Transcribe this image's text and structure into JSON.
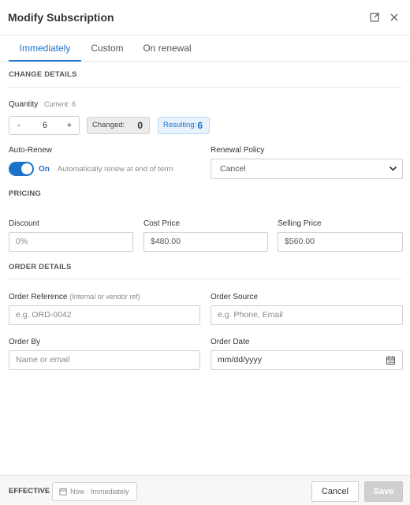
{
  "header": {
    "title": "Modify Subscription",
    "icons": [
      "expand-icon",
      "close-icon"
    ]
  },
  "tabs": [
    {
      "label": "Immediately",
      "active": true
    },
    {
      "label": "Custom",
      "active": false
    },
    {
      "label": "On renewal",
      "active": false
    }
  ],
  "change_details": {
    "title": "CHANGE DETAILS",
    "quantity_label": "Quantity",
    "current_label": "Current: 6",
    "minus": "-",
    "value": "6",
    "plus": "+",
    "changed_label": "Changed:",
    "changed_value": "0",
    "resulting_label": "Resulting:",
    "resulting_value": "6",
    "auto_renew_label": "Auto-Renew",
    "toggle_state": "On",
    "toggle_hint": "Automatically renew at end of term",
    "renewal_policy_label": "Renewal Policy",
    "renewal_policy_value": "Cancel"
  },
  "pricing": {
    "title": "PRICING",
    "discount_label": "Discount",
    "discount_placeholder": "0%",
    "cost_label": "Cost Price",
    "cost_value": "$480.00",
    "selling_label": "Selling Price",
    "selling_value": "$560.00"
  },
  "order_details": {
    "title": "ORDER DETAILS",
    "reference_label": "Order Reference",
    "reference_hint": "(Internal or vendor ref)",
    "reference_placeholder": "e.g. ORD-0042",
    "source_label": "Order Source",
    "source_placeholder": "e.g. Phone, Email",
    "order_by_label": "Order By",
    "order_by_placeholder": "Name or email",
    "order_date_label": "Order Date",
    "order_date_placeholder": "mm/dd/yyyy"
  },
  "footer": {
    "effective_label": "EFFECTIVE",
    "effective_value": "Now · Immediately",
    "cancel": "Cancel",
    "save": "Save"
  },
  "colors": {
    "accent": "#1a73c9",
    "resulting_bg": "#e8f3fd",
    "changed_bg": "#ececec"
  }
}
